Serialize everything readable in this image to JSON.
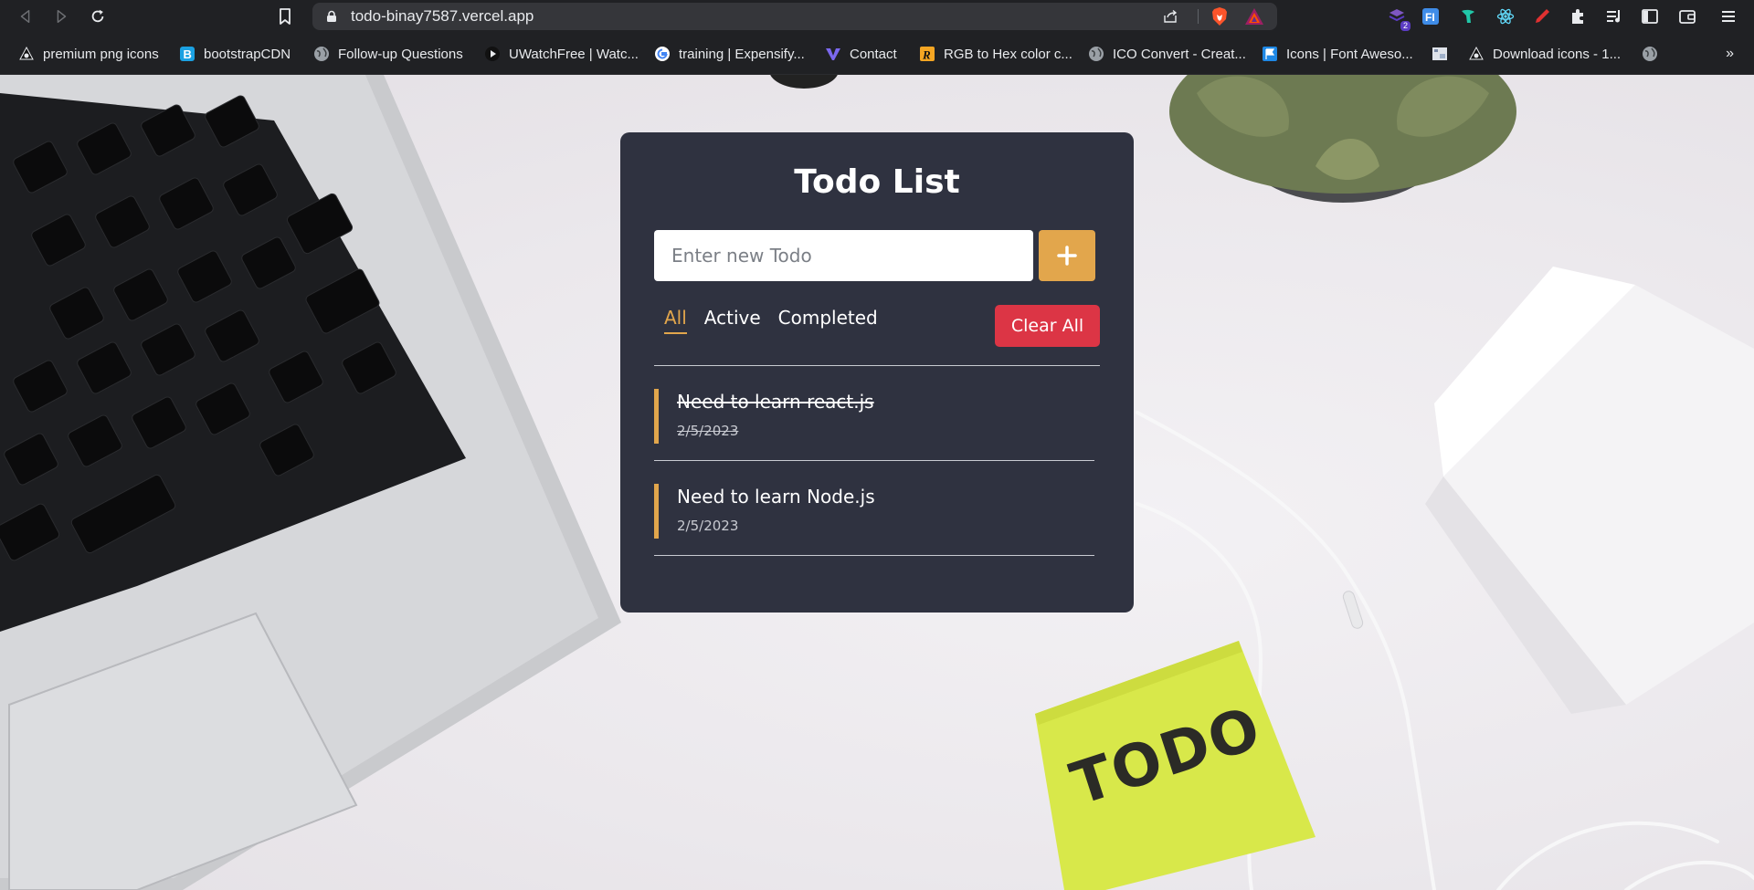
{
  "browser": {
    "url": "todo-binay7587.vercel.app",
    "nav": [
      "back-icon",
      "forward-icon",
      "reload-icon"
    ],
    "extensions": [
      {
        "icon": "stack-extension-icon",
        "badge": "2",
        "color": "#5b3cc4"
      },
      {
        "icon": "fi-extension-icon",
        "badge": "",
        "color": "#3f8ce8"
      },
      {
        "icon": "bird-extension-icon",
        "badge": "",
        "color": "#21c7a8"
      },
      {
        "icon": "react-extension-icon",
        "badge": "",
        "color": "#61dafb"
      },
      {
        "icon": "pen-extension-icon",
        "badge": "",
        "color": "#e03131"
      },
      {
        "icon": "puzzle-icon",
        "badge": "",
        "color": "#e8eaed"
      },
      {
        "icon": "media-queue-icon",
        "badge": "",
        "color": "#e8eaed"
      },
      {
        "icon": "sidebar-icon",
        "badge": "",
        "color": "#e8eaed"
      },
      {
        "icon": "wallet-icon",
        "badge": "",
        "color": "#e8eaed"
      },
      {
        "icon": "menu-icon",
        "badge": "",
        "color": "#e8eaed"
      }
    ]
  },
  "bookmarks": [
    {
      "label": "premium png icons",
      "icon": "globe-dark-icon"
    },
    {
      "label": "bootstrapCDN",
      "icon": "bootstrap-icon"
    },
    {
      "label": "Follow-up Questions",
      "icon": "globe-icon"
    },
    {
      "label": "UWatchFree | Watc...",
      "icon": "play-icon"
    },
    {
      "label": "training | Expensify...",
      "icon": "google-icon"
    },
    {
      "label": "Contact",
      "icon": "v-logo-icon"
    },
    {
      "label": "RGB to Hex color c...",
      "icon": "r-logo-icon"
    },
    {
      "label": "ICO Convert - Creat...",
      "icon": "globe-icon"
    },
    {
      "label": "Icons | Font Aweso...",
      "icon": "flag-icon"
    },
    {
      "label": "",
      "icon": "image-icon"
    },
    {
      "label": "Download icons - 1...",
      "icon": "globe-dark-icon"
    },
    {
      "label": "",
      "icon": "globe-icon"
    }
  ],
  "bookmarks_overflow": "»",
  "app": {
    "title": "Todo List",
    "input_placeholder": "Enter new Todo",
    "add_icon": "plus-icon",
    "filters": [
      "All",
      "Active",
      "Completed"
    ],
    "active_filter": "All",
    "clear_label": "Clear All",
    "todos": [
      {
        "text": "Need to learn react.js",
        "date": "2/5/2023",
        "completed": true
      },
      {
        "text": "Need to learn Node.js",
        "date": "2/5/2023",
        "completed": false
      }
    ]
  },
  "scene": {
    "sticky_note_text": "TODO"
  },
  "colors": {
    "card_bg": "#2f3240",
    "accent": "#e2a64c",
    "danger": "#dc3545",
    "sticky_note": "#d8e84a"
  }
}
